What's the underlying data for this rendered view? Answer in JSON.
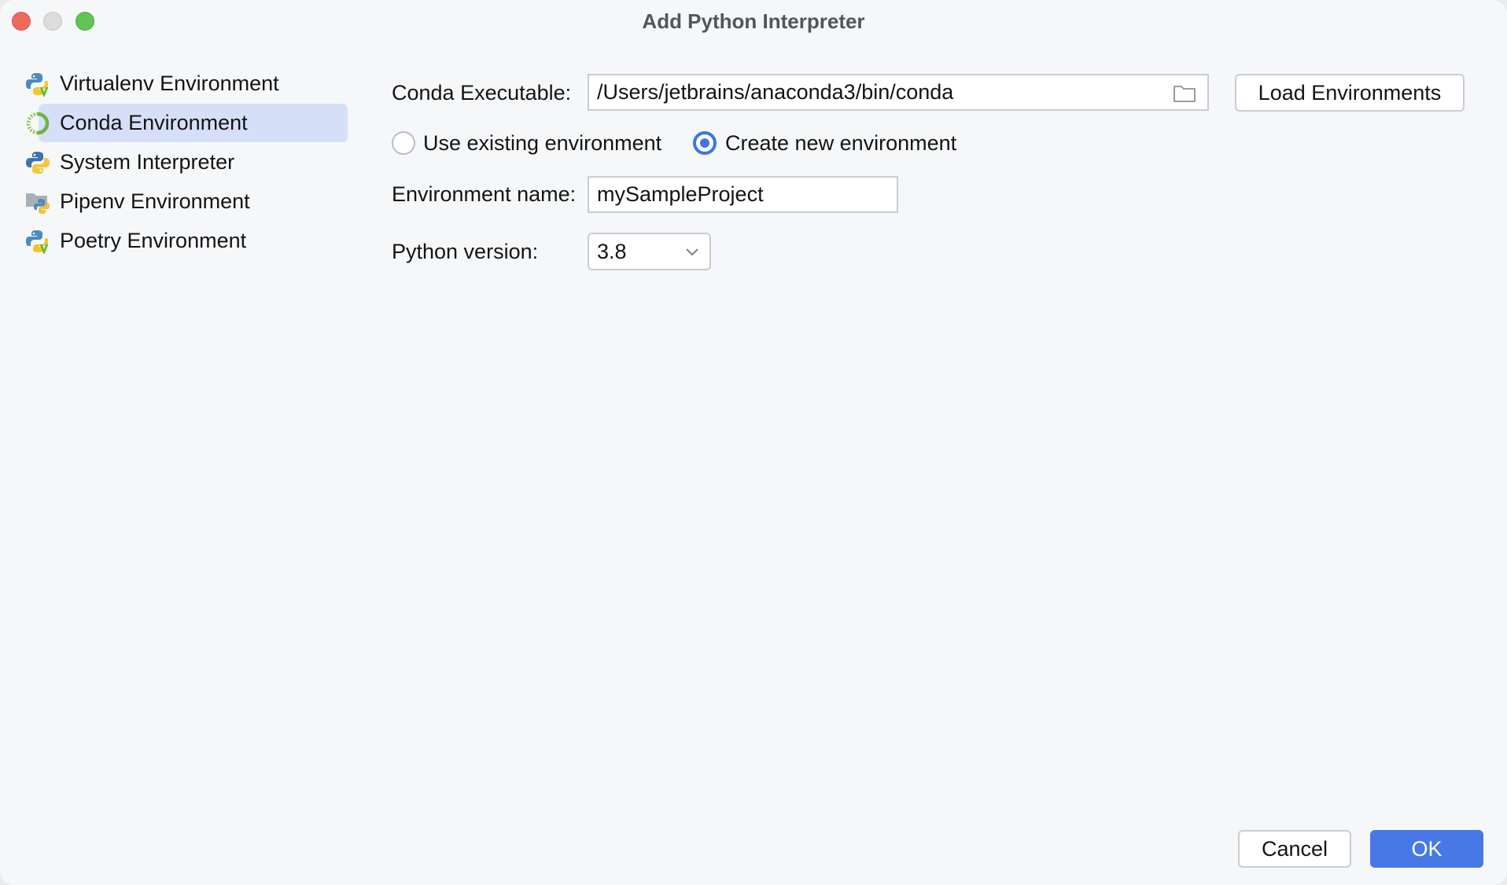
{
  "window": {
    "title": "Add Python Interpreter",
    "controls": [
      "close",
      "minimize",
      "maximize"
    ]
  },
  "sidebar": {
    "selected_index": 1,
    "items": [
      {
        "label": "Virtualenv Environment",
        "icon": "virtualenv-python-icon"
      },
      {
        "label": "Conda Environment",
        "icon": "conda-icon"
      },
      {
        "label": "System Interpreter",
        "icon": "python-icon"
      },
      {
        "label": "Pipenv Environment",
        "icon": "pipenv-folder-python-icon"
      },
      {
        "label": "Poetry Environment",
        "icon": "poetry-python-icon"
      }
    ]
  },
  "form": {
    "conda_executable": {
      "label": "Conda Executable:",
      "value": "/Users/jetbrains/anaconda3/bin/conda",
      "browse_icon": "folder-icon"
    },
    "load_environments_button": "Load Environments",
    "mode": {
      "options": [
        "Use existing environment",
        "Create new environment"
      ],
      "selected": "Create new environment"
    },
    "environment_name": {
      "label": "Environment name:",
      "value": "mySampleProject"
    },
    "python_version": {
      "label": "Python version:",
      "value": "3.8"
    }
  },
  "footer": {
    "cancel_label": "Cancel",
    "ok_label": "OK"
  },
  "colors": {
    "accent": "#4778e6",
    "selection": "#d5e0f8",
    "background": "#f6f7f9"
  }
}
